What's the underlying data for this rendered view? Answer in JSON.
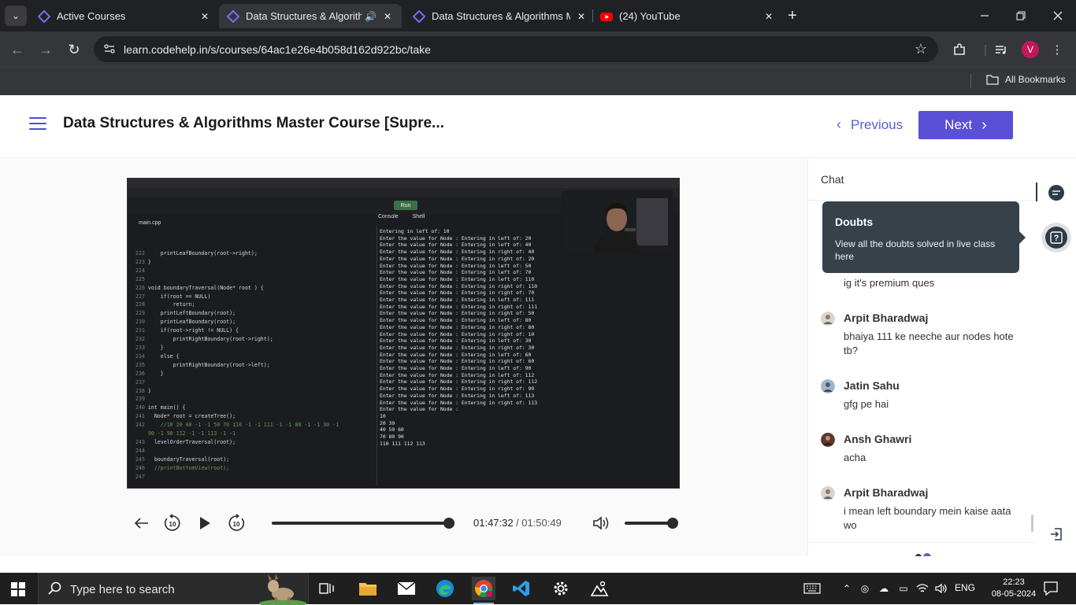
{
  "browser": {
    "tabs": [
      {
        "title": "Active Courses",
        "active": false
      },
      {
        "title": "Data Structures & Algorithms",
        "active": true
      },
      {
        "title": "Data Structures & Algorithms M",
        "active": false
      },
      {
        "title": "(24) YouTube",
        "active": false
      }
    ],
    "url": "learn.codehelp.in/s/courses/64ac1e26e4b058d162d922bc/take",
    "profile_initial": "V",
    "bookmarks_label": "All Bookmarks"
  },
  "header": {
    "course_title": "Data Structures & Algorithms Master Course [Supre...",
    "previous_label": "Previous",
    "next_label": "Next"
  },
  "player": {
    "current_time": "01:47:32",
    "duration": "/ 01:50:49",
    "progress": 0.97,
    "volume": 1.0
  },
  "video_content": {
    "code_lines": [
      {
        "n": "222",
        "t": "    printLeafBoundary(root->right);"
      },
      {
        "n": "223",
        "t": "}"
      },
      {
        "n": "224",
        "t": ""
      },
      {
        "n": "225",
        "t": ""
      },
      {
        "n": "226",
        "t": "void boundaryTraversal(Node* root ) {"
      },
      {
        "n": "227",
        "t": "    if(root == NULL)"
      },
      {
        "n": "228",
        "t": "        return;"
      },
      {
        "n": "229",
        "t": "    printLeftBoundary(root);"
      },
      {
        "n": "230",
        "t": "    printLeafBoundary(root);"
      },
      {
        "n": "231",
        "t": "    if(root->right != NULL) {"
      },
      {
        "n": "232",
        "t": "        printRightBoundary(root->right);"
      },
      {
        "n": "233",
        "t": "    }"
      },
      {
        "n": "234",
        "t": "    else {"
      },
      {
        "n": "235",
        "t": "        printRightBoundary(root->left);"
      },
      {
        "n": "236",
        "t": "    }"
      },
      {
        "n": "237",
        "t": ""
      },
      {
        "n": "238",
        "t": "}"
      },
      {
        "n": "239",
        "t": ""
      },
      {
        "n": "240",
        "t": "int main() {"
      },
      {
        "n": "241",
        "t": "  Node* root = createTree();"
      },
      {
        "n": "242",
        "t": "    //10 20 40 -1 -1 50 70 110 -1 -1 111 -1 -1 80 -1 -1 30 -1"
      },
      {
        "n": "",
        "t": "90 -1 90 112 -1 -1 113 -1 -1"
      },
      {
        "n": "243",
        "t": "  levelOrderTraversal(root);"
      },
      {
        "n": "244",
        "t": ""
      },
      {
        "n": "245",
        "t": "  boundaryTraversal(root);"
      },
      {
        "n": "246",
        "t": "  //printBottomView(root);"
      },
      {
        "n": "247",
        "t": ""
      }
    ],
    "console_lines": [
      "Entering in left of: 10",
      "Enter the value for Node : Entering in left of: 20",
      "Enter the value for Node : Entering in left of: 40",
      "Enter the value for Node : Entering in right of: 40",
      "Enter the value for Node : Entering in right of: 20",
      "Enter the value for Node : Entering in left of: 50",
      "Enter the value for Node : Entering in left of: 70",
      "Enter the value for Node : Entering in left of: 110",
      "Enter the value for Node : Entering in right of: 110",
      "Enter the value for Node : Entering in right of: 70",
      "Enter the value for Node : Entering in left of: 111",
      "Enter the value for Node : Entering in right of: 111",
      "Enter the value for Node : Entering in right of: 50",
      "Enter the value for Node : Entering in left of: 80",
      "Enter the value for Node : Entering in right of: 80",
      "Enter the value for Node : Entering in right of: 10",
      "Enter the value for Node : Entering in left of: 30",
      "Enter the value for Node : Entering in right of: 30",
      "Enter the value for Node : Entering in left of: 60",
      "Enter the value for Node : Entering in right of: 60",
      "Enter the value for Node : Entering in left of: 90",
      "Enter the value for Node : Entering in left of: 112",
      "Enter the value for Node : Entering in right of: 112",
      "Enter the value for Node : Entering in right of: 90",
      "Enter the value for Node : Entering in left of: 113",
      "Enter the value for Node : Entering in right of: 113",
      "Enter the value for Node :",
      "10",
      "20 30",
      "40 50 60",
      "70 80 90",
      "110 111 112 113"
    ],
    "run_label": "Run",
    "file_tab": "main.cpp",
    "console_tab": "Console",
    "shell_tab": "Shell"
  },
  "chat": {
    "header": "Chat",
    "first_message": "ig it's premium ques",
    "messages": [
      {
        "name": "Arpit Bharadwaj",
        "text": "bhaiya 111 ke neeche aur nodes hote tb?"
      },
      {
        "name": "Jatin Sahu",
        "text": "gfg pe hai"
      },
      {
        "name": "Ansh Ghawri",
        "text": "acha"
      },
      {
        "name": "Arpit Bharadwaj",
        "text": "i mean left boundary mein kaise aata wo"
      }
    ]
  },
  "tooltip": {
    "title": "Doubts",
    "description": "View all the doubts solved in live class here"
  },
  "taskbar": {
    "search_placeholder": "Type here to search",
    "language": "ENG",
    "time": "22:23",
    "date": "08-05-2024"
  },
  "colors": {
    "accent": "#5b4fd6",
    "tooltip_bg": "#36414a",
    "chrome_dark": "#202124",
    "chrome_mid": "#35363a"
  }
}
